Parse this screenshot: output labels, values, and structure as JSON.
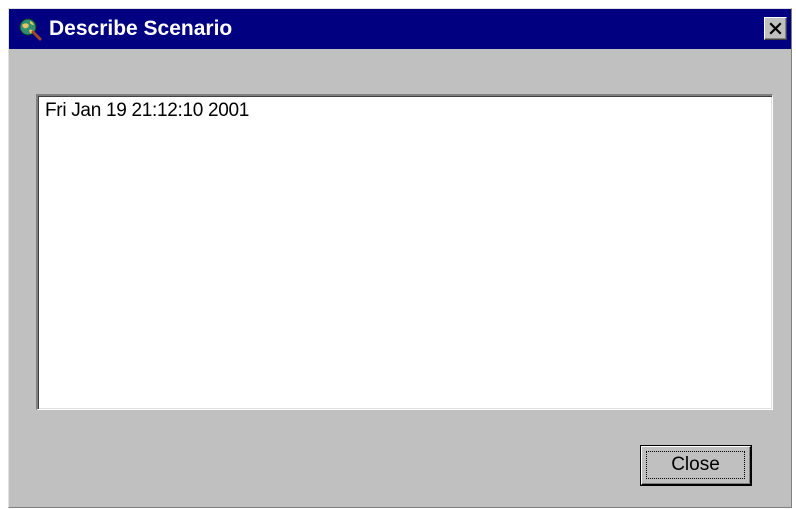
{
  "window": {
    "title": "Describe Scenario",
    "title_icon": "globe-magnifier-icon",
    "close_icon": "close-icon"
  },
  "description": {
    "text": "Fri Jan 19 21:12:10 2001"
  },
  "buttons": {
    "close_label": "Close"
  },
  "colors": {
    "titlebar": "#000080",
    "dialog_face": "#c0c0c0",
    "text_area_bg": "#ffffff"
  }
}
